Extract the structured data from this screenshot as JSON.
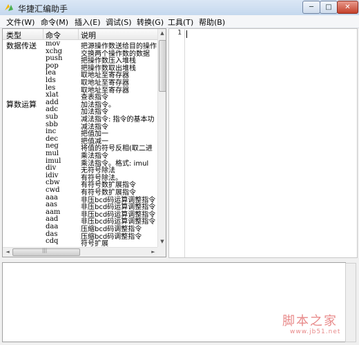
{
  "window": {
    "title": "华捷汇编助手",
    "min_symbol": "─",
    "max_symbol": "□",
    "close_symbol": "✕"
  },
  "menu": [
    "文件(W)",
    "命令(M)",
    "插入(E)",
    "调试(S)",
    "转换(G)",
    "工具(T)",
    "帮助(B)"
  ],
  "list": {
    "headers": {
      "type": "类型",
      "command": "命令",
      "desc": "说明"
    },
    "rows": [
      {
        "type": "数据传送",
        "cmd": "mov",
        "desc": "把源操作数送给目的操作"
      },
      {
        "type": "",
        "cmd": "xchg",
        "desc": "交换两个操作数的数据"
      },
      {
        "type": "",
        "cmd": "push",
        "desc": "把操作数压入堆栈"
      },
      {
        "type": "",
        "cmd": "pop",
        "desc": "把操作数取出堆栈"
      },
      {
        "type": "",
        "cmd": "lea",
        "desc": "取地址至寄存器"
      },
      {
        "type": "",
        "cmd": "lds",
        "desc": "取地址至寄存器"
      },
      {
        "type": "",
        "cmd": "les",
        "desc": "取地址至寄存器"
      },
      {
        "type": "",
        "cmd": "xlat",
        "desc": "查表指令"
      },
      {
        "type": "算数运算",
        "cmd": "add",
        "desc": "加法指令。"
      },
      {
        "type": "",
        "cmd": "adc",
        "desc": "加法指令"
      },
      {
        "type": "",
        "cmd": "sub",
        "desc": "减法指令: 指令的基本功"
      },
      {
        "type": "",
        "cmd": "sbb",
        "desc": "减法指令"
      },
      {
        "type": "",
        "cmd": "inc",
        "desc": "把值加一"
      },
      {
        "type": "",
        "cmd": "dec",
        "desc": "把值减一"
      },
      {
        "type": "",
        "cmd": "neg",
        "desc": "将值的符号反相(取二进"
      },
      {
        "type": "",
        "cmd": "mul",
        "desc": "乘法指令"
      },
      {
        "type": "",
        "cmd": "imul",
        "desc": "乘法指令。格式: imul "
      },
      {
        "type": "",
        "cmd": "div",
        "desc": "无符号除法"
      },
      {
        "type": "",
        "cmd": "idiv",
        "desc": "有符号除法。"
      },
      {
        "type": "",
        "cmd": "cbw",
        "desc": "有符号数扩展指令"
      },
      {
        "type": "",
        "cmd": "cwd",
        "desc": "有符号数扩展指令"
      },
      {
        "type": "",
        "cmd": "aaa",
        "desc": "非压bcd码运算调整指令"
      },
      {
        "type": "",
        "cmd": "aas",
        "desc": "非压bcd码运算调整指令"
      },
      {
        "type": "",
        "cmd": "aam",
        "desc": "非压bcd码运算调整指令"
      },
      {
        "type": "",
        "cmd": "aad",
        "desc": "非压bcd码运算调整指令"
      },
      {
        "type": "",
        "cmd": "daa",
        "desc": "压缩bcd码调整指令"
      },
      {
        "type": "",
        "cmd": "das",
        "desc": "压缩bcd码调整指令"
      },
      {
        "type": "",
        "cmd": "cdq",
        "desc": "符号扩展"
      }
    ],
    "scroll_up": "▲",
    "scroll_down": "▼",
    "scroll_left": "◄",
    "scroll_right": "►",
    "grip": "|||"
  },
  "editor": {
    "line_number": "1"
  },
  "watermark": {
    "main": "脚本之家",
    "sub": "www.jb51.net"
  },
  "colors": {
    "watermark": "#e88a8a",
    "titlebar": "#dbe7f5"
  }
}
